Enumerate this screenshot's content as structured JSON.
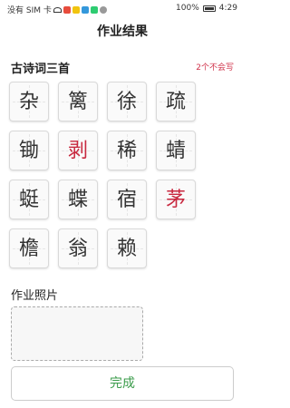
{
  "status_bar": {
    "carrier": "没有 SIM 卡",
    "battery": "100%",
    "time": "4:29",
    "icons": [
      "wifi-icon",
      "app-icon",
      "app-icon",
      "app-icon",
      "app-icon",
      "cloud-icon"
    ],
    "colors": {
      "text": "#333333"
    }
  },
  "header": {
    "title": "作业结果"
  },
  "poem_section": {
    "title": "古诗词三首",
    "note": "2个不会写",
    "note_color": "#d0334b",
    "characters": [
      {
        "char": "杂",
        "wrong": false
      },
      {
        "char": "篱",
        "wrong": false
      },
      {
        "char": "徐",
        "wrong": false
      },
      {
        "char": "疏",
        "wrong": false
      },
      {
        "char": "锄",
        "wrong": false
      },
      {
        "char": "剥",
        "wrong": true
      },
      {
        "char": "稀",
        "wrong": false
      },
      {
        "char": "蜻",
        "wrong": false
      },
      {
        "char": "蜓",
        "wrong": false
      },
      {
        "char": "蝶",
        "wrong": false
      },
      {
        "char": "宿",
        "wrong": false
      },
      {
        "char": "茅",
        "wrong": true
      },
      {
        "char": "檐",
        "wrong": false
      },
      {
        "char": "翁",
        "wrong": false
      },
      {
        "char": "赖",
        "wrong": false
      }
    ]
  },
  "photo_section": {
    "title": "作业照片"
  },
  "done_button": {
    "label": "完成",
    "color": "#3a9b4a"
  }
}
